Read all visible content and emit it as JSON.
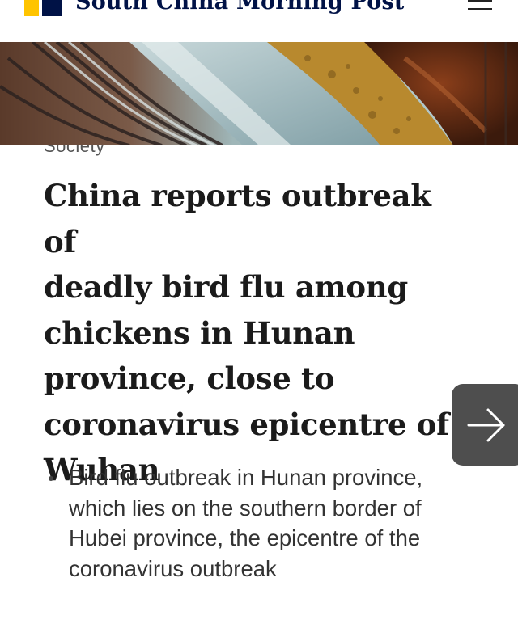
{
  "header": {
    "brand_name": "South China Morning Post",
    "colors": {
      "brand_yellow": "#ffc400",
      "brand_navy": "#001246"
    },
    "menu_icon": "hamburger-menu-icon"
  },
  "hero": {
    "image": "chickens in cage feeding trough photo"
  },
  "article": {
    "section": "Society",
    "headline_lines": [
      "China reports outbreak of",
      "deadly bird flu among",
      "chickens in Hunan",
      "province, close to",
      "coronavirus epicentre of",
      "Wuhan"
    ],
    "summary_points": [
      "Bird flu outbreak in Hunan province, which lies on the southern border of Hubei province, the epicentre of the coronavirus outbreak"
    ]
  },
  "next_button": {
    "icon": "arrow-right-icon",
    "color": "#4e4e4e"
  }
}
